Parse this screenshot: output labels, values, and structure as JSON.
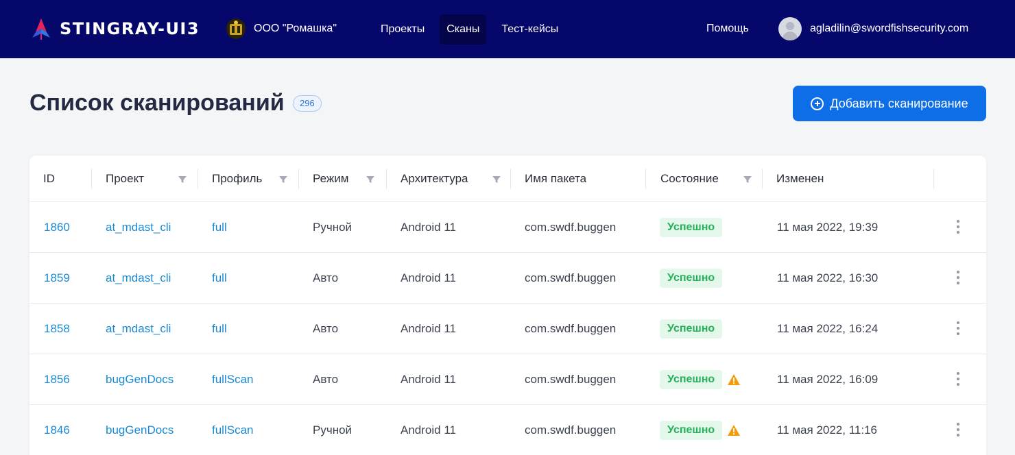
{
  "header": {
    "logo_text": "STINGRAY-UI3",
    "org_name": "ООО \"Ромашка\"",
    "nav": [
      {
        "label": "Проекты",
        "active": false
      },
      {
        "label": "Сканы",
        "active": true
      },
      {
        "label": "Тест-кейсы",
        "active": false
      }
    ],
    "help_label": "Помощь",
    "user_email": "agladilin@swordfishsecurity.com",
    "bar_color": "#05076b"
  },
  "page": {
    "title": "Список сканирований",
    "count": "296",
    "add_button_label": "Добавить сканирование",
    "accent_color": "#0d6ee8"
  },
  "table": {
    "columns": [
      {
        "label": "ID",
        "filter": false
      },
      {
        "label": "Проект",
        "filter": true
      },
      {
        "label": "Профиль",
        "filter": true
      },
      {
        "label": "Режим",
        "filter": true
      },
      {
        "label": "Архитектура",
        "filter": true
      },
      {
        "label": "Имя пакета",
        "filter": false
      },
      {
        "label": "Состояние",
        "filter": true
      },
      {
        "label": "Изменен",
        "filter": false
      }
    ],
    "rows": [
      {
        "id": "1860",
        "project": "at_mdast_cli",
        "profile": "full",
        "mode": "Ручной",
        "arch": "Android 11",
        "package": "com.swdf.buggen",
        "status": "Успешно",
        "warning": false,
        "modified": "11 мая 2022, 19:39"
      },
      {
        "id": "1859",
        "project": "at_mdast_cli",
        "profile": "full",
        "mode": "Авто",
        "arch": "Android 11",
        "package": "com.swdf.buggen",
        "status": "Успешно",
        "warning": false,
        "modified": "11 мая 2022, 16:30"
      },
      {
        "id": "1858",
        "project": "at_mdast_cli",
        "profile": "full",
        "mode": "Авто",
        "arch": "Android 11",
        "package": "com.swdf.buggen",
        "status": "Успешно",
        "warning": false,
        "modified": "11 мая 2022, 16:24"
      },
      {
        "id": "1856",
        "project": "bugGenDocs",
        "profile": "fullScan",
        "mode": "Авто",
        "arch": "Android 11",
        "package": "com.swdf.buggen",
        "status": "Успешно",
        "warning": true,
        "modified": "11 мая 2022, 16:09"
      },
      {
        "id": "1846",
        "project": "bugGenDocs",
        "profile": "fullScan",
        "mode": "Ручной",
        "arch": "Android 11",
        "package": "com.swdf.buggen",
        "status": "Успешно",
        "warning": true,
        "modified": "11 мая 2022, 11:16"
      }
    ],
    "status_colors": {
      "success_bg": "#e3f7ea",
      "success_text": "#26b05a",
      "warning_icon": "#f59a0b"
    }
  }
}
